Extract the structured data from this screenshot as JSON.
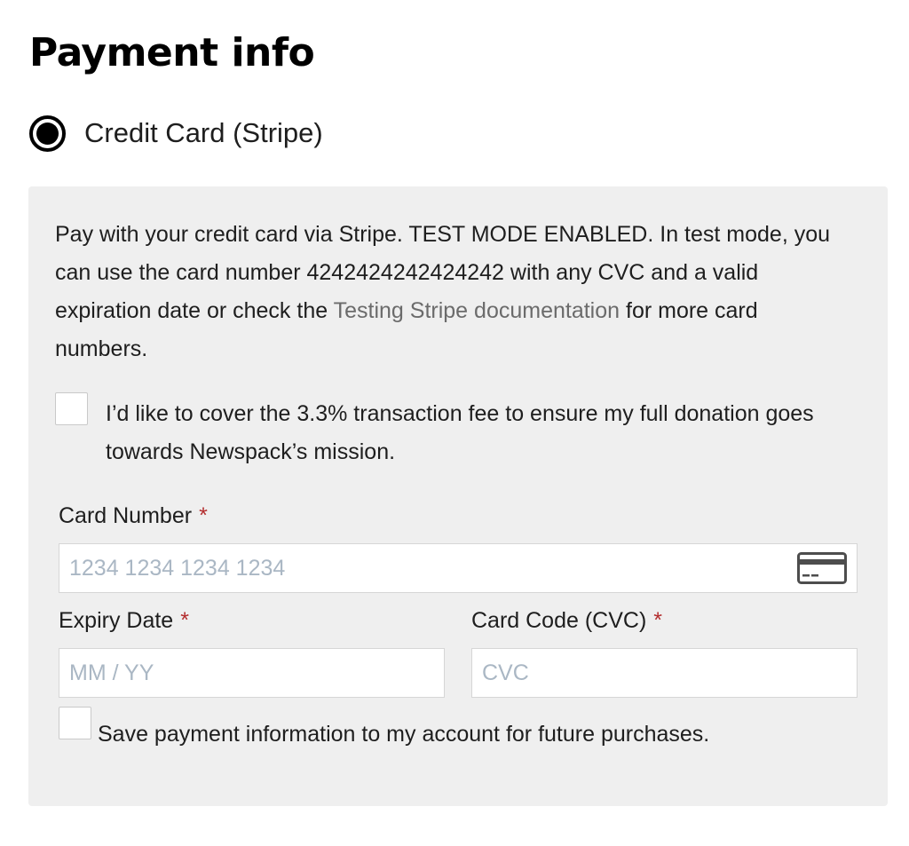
{
  "section": {
    "title": "Payment info"
  },
  "payment_method": {
    "label": "Credit Card (Stripe)",
    "selected": true
  },
  "stripe": {
    "description_before": "Pay with your credit card via Stripe. TEST MODE ENABLED. In test mode, you can use the card number 4242424242424242 with any CVC and a valid expiration date or check the ",
    "description_link": "Testing Stripe documentation",
    "description_after": " for more card numbers.",
    "fee_checkbox_label": "I’d like to cover the 3.3% transaction fee to ensure my full donation goes towards Newspack’s mission.",
    "card_number": {
      "label": "Card Number",
      "required_mark": "*",
      "placeholder": "1234 1234 1234 1234",
      "icon": "credit-card-icon"
    },
    "expiry": {
      "label": "Expiry Date",
      "required_mark": "*",
      "placeholder": "MM / YY"
    },
    "cvc": {
      "label": "Card Code (CVC)",
      "required_mark": "*",
      "placeholder": "CVC"
    },
    "save_checkbox_label": "Save payment information to my account for future purchases."
  },
  "colors": {
    "panel_bg": "#efefef",
    "required": "#b32d2e",
    "link": "#6b6b6b",
    "placeholder": "#aab7c4"
  }
}
